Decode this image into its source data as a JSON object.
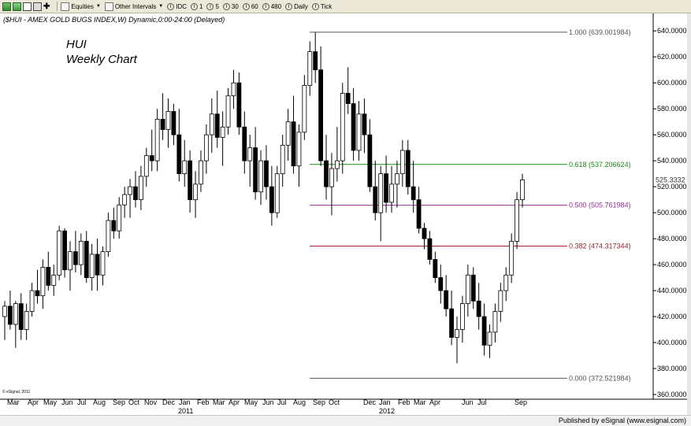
{
  "toolbar": {
    "equities_label": "Equities",
    "intervals_label": "Other Intervals",
    "buttons": [
      "IDC",
      "1",
      "5",
      "30",
      "60",
      "480",
      "Daily",
      "Tick"
    ]
  },
  "chart_data": {
    "type": "candlestick",
    "header": "($HUI - AMEX GOLD BUGS INDEX,W) Dynamic,0:00-24:00 (Delayed)",
    "annotation_line1": "HUI",
    "annotation_line2": "Weekly Chart",
    "copyright": "© eSignal, 2011",
    "ylim": [
      360,
      645
    ],
    "y_ticks": [
      360,
      380,
      400,
      420,
      440,
      460,
      480,
      500,
      520,
      540,
      560,
      580,
      600,
      620,
      640
    ],
    "y_tick_labels": [
      "360.0000",
      "380.0000",
      "400.0000",
      "420.0000",
      "440.0000",
      "460.0000",
      "480.0000",
      "500.0000",
      "520.0000",
      "540.0000",
      "560.0000",
      "580.0000",
      "600.0000",
      "620.0000",
      "640.0000"
    ],
    "last_value": 525.3332,
    "last_value_label": "525.3332",
    "x_month_labels": [
      "Mar",
      "Apr",
      "May",
      "Jun",
      "Jul",
      "Aug",
      "Sep",
      "Oct",
      "Nov",
      "Dec",
      "Jan",
      "Feb",
      "Mar",
      "Apr",
      "May",
      "Jun",
      "Jul",
      "Aug",
      "Sep",
      "Oct",
      "Dec",
      "Jan",
      "Feb",
      "Mar",
      "Apr",
      "Jun",
      "Jul",
      "Sep"
    ],
    "x_year_labels": [
      "2011",
      "2012"
    ],
    "fib_levels": [
      {
        "ratio": "1.000",
        "value": 639.001984,
        "label": "1.000 (639.001984)",
        "color": "#555555"
      },
      {
        "ratio": "0.618",
        "value": 537.206624,
        "label": "0.618 (537.206624)",
        "color": "#1a8a1a"
      },
      {
        "ratio": "0.500",
        "value": 505.761984,
        "label": "0.500 (505.761984)",
        "color": "#9a309a"
      },
      {
        "ratio": "0.382",
        "value": 474.317344,
        "label": "0.382 (474.317344)",
        "color": "#a02030"
      },
      {
        "ratio": "0.000",
        "value": 372.521984,
        "label": "0.000 (372.521984)",
        "color": "#555555"
      }
    ],
    "ohlc": [
      [
        420,
        432,
        402,
        428
      ],
      [
        428,
        440,
        410,
        414
      ],
      [
        414,
        432,
        396,
        430
      ],
      [
        430,
        438,
        402,
        410
      ],
      [
        410,
        430,
        402,
        424
      ],
      [
        424,
        446,
        420,
        440
      ],
      [
        440,
        456,
        430,
        436
      ],
      [
        436,
        464,
        426,
        458
      ],
      [
        458,
        470,
        440,
        444
      ],
      [
        444,
        460,
        436,
        452
      ],
      [
        452,
        490,
        448,
        486
      ],
      [
        486,
        488,
        450,
        456
      ],
      [
        456,
        478,
        440,
        470
      ],
      [
        470,
        486,
        454,
        460
      ],
      [
        460,
        484,
        452,
        478
      ],
      [
        478,
        486,
        446,
        450
      ],
      [
        450,
        476,
        440,
        468
      ],
      [
        468,
        480,
        440,
        452
      ],
      [
        452,
        474,
        444,
        470
      ],
      [
        470,
        500,
        466,
        494
      ],
      [
        494,
        504,
        480,
        486
      ],
      [
        486,
        512,
        480,
        506
      ],
      [
        506,
        520,
        496,
        514
      ],
      [
        514,
        526,
        496,
        520
      ],
      [
        520,
        532,
        504,
        510
      ],
      [
        510,
        536,
        502,
        528
      ],
      [
        528,
        550,
        520,
        544
      ],
      [
        544,
        564,
        532,
        540
      ],
      [
        540,
        580,
        532,
        572
      ],
      [
        572,
        592,
        556,
        564
      ],
      [
        564,
        588,
        550,
        578
      ],
      [
        578,
        584,
        552,
        560
      ],
      [
        560,
        580,
        524,
        530
      ],
      [
        530,
        556,
        520,
        540
      ],
      [
        540,
        548,
        500,
        510
      ],
      [
        510,
        532,
        496,
        522
      ],
      [
        522,
        548,
        516,
        540
      ],
      [
        540,
        568,
        530,
        560
      ],
      [
        560,
        588,
        546,
        576
      ],
      [
        576,
        594,
        550,
        558
      ],
      [
        558,
        578,
        536,
        566
      ],
      [
        566,
        596,
        560,
        590
      ],
      [
        590,
        610,
        580,
        600
      ],
      [
        600,
        608,
        560,
        566
      ],
      [
        566,
        578,
        530,
        540
      ],
      [
        540,
        560,
        520,
        550
      ],
      [
        550,
        566,
        510,
        516
      ],
      [
        516,
        548,
        506,
        540
      ],
      [
        540,
        552,
        510,
        520
      ],
      [
        520,
        536,
        490,
        500
      ],
      [
        500,
        536,
        496,
        530
      ],
      [
        530,
        560,
        520,
        552
      ],
      [
        552,
        580,
        540,
        570
      ],
      [
        570,
        590,
        530,
        536
      ],
      [
        536,
        568,
        520,
        562
      ],
      [
        562,
        606,
        556,
        598
      ],
      [
        598,
        632,
        590,
        624
      ],
      [
        624,
        639,
        600,
        610
      ],
      [
        610,
        628,
        536,
        540
      ],
      [
        540,
        560,
        510,
        520
      ],
      [
        520,
        546,
        498,
        534
      ],
      [
        534,
        566,
        524,
        540
      ],
      [
        540,
        600,
        530,
        592
      ],
      [
        592,
        612,
        576,
        584
      ],
      [
        584,
        596,
        540,
        548
      ],
      [
        548,
        586,
        540,
        576
      ],
      [
        576,
        588,
        546,
        560
      ],
      [
        560,
        572,
        516,
        520
      ],
      [
        520,
        540,
        494,
        500
      ],
      [
        500,
        536,
        478,
        530
      ],
      [
        530,
        544,
        500,
        508
      ],
      [
        508,
        536,
        500,
        522
      ],
      [
        522,
        540,
        504,
        530
      ],
      [
        530,
        556,
        520,
        548
      ],
      [
        548,
        556,
        514,
        520
      ],
      [
        520,
        540,
        500,
        510
      ],
      [
        510,
        520,
        484,
        488
      ],
      [
        488,
        492,
        472,
        480
      ],
      [
        480,
        486,
        460,
        464
      ],
      [
        464,
        470,
        446,
        450
      ],
      [
        450,
        460,
        430,
        440
      ],
      [
        440,
        452,
        420,
        426
      ],
      [
        426,
        440,
        398,
        404
      ],
      [
        404,
        420,
        384,
        410
      ],
      [
        410,
        436,
        400,
        430
      ],
      [
        430,
        460,
        420,
        452
      ],
      [
        452,
        458,
        426,
        432
      ],
      [
        432,
        446,
        410,
        420
      ],
      [
        420,
        430,
        390,
        398
      ],
      [
        398,
        414,
        388,
        408
      ],
      [
        408,
        430,
        400,
        424
      ],
      [
        424,
        446,
        416,
        440
      ],
      [
        440,
        458,
        432,
        452
      ],
      [
        452,
        484,
        446,
        478
      ],
      [
        478,
        516,
        472,
        510
      ],
      [
        510,
        530,
        504,
        525.3332
      ]
    ],
    "candles_start_index": 0
  },
  "footer": {
    "published_by": "Published by eSignal (www.esignal.com)"
  }
}
